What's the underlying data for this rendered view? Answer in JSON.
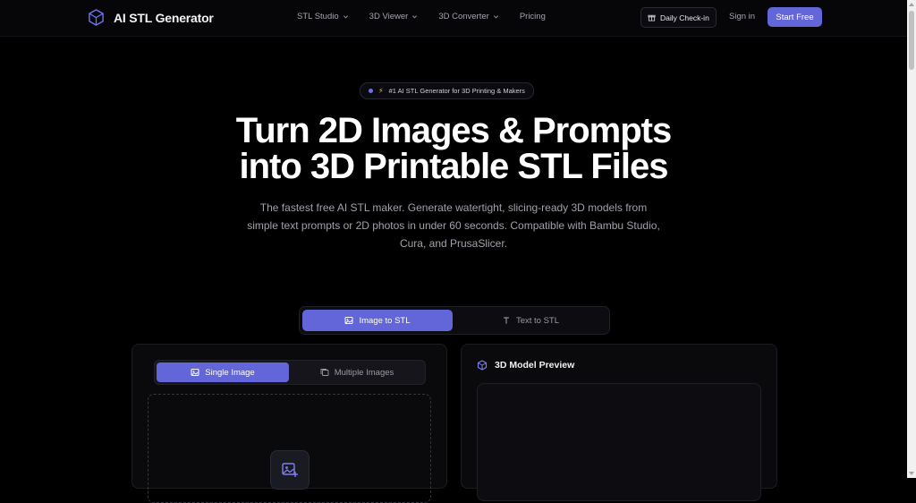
{
  "header": {
    "brand": "AI STL Generator",
    "nav": [
      {
        "label": "STL Studio",
        "dropdown": true
      },
      {
        "label": "3D Viewer",
        "dropdown": true
      },
      {
        "label": "3D Converter",
        "dropdown": true
      },
      {
        "label": "Pricing",
        "dropdown": false
      }
    ],
    "daily_checkin": "Daily Check-in",
    "sign_in": "Sign in",
    "start_free": "Start Free"
  },
  "hero": {
    "badge": "#1 AI STL Generator for 3D Printing & Makers",
    "title_line1": "Turn 2D Images & Prompts",
    "title_line2": "into 3D Printable STL Files",
    "subtitle": "The fastest free AI STL maker. Generate watertight, slicing-ready 3D models from simple text prompts or 2D photos in under 60 seconds. Compatible with Bambu Studio, Cura, and PrusaSlicer."
  },
  "mode_tabs": {
    "image_to_stl": "Image to STL",
    "text_to_stl": "Text to STL",
    "active": "image_to_stl"
  },
  "upload_panel": {
    "single_image": "Single Image",
    "multiple_images": "Multiple Images",
    "active": "single_image"
  },
  "preview_panel": {
    "title": "3D Model Preview"
  },
  "colors": {
    "accent": "#6366d8",
    "background": "#000000",
    "panel": "#0a0a0d",
    "muted_text": "#a0a0aa"
  },
  "icons": {
    "logo": "cube-logo-icon",
    "checkin": "gift-icon",
    "image": "image-icon",
    "text": "text-t-icon",
    "multiple": "images-icon",
    "upload": "image-plus-icon",
    "preview": "cube-icon"
  }
}
